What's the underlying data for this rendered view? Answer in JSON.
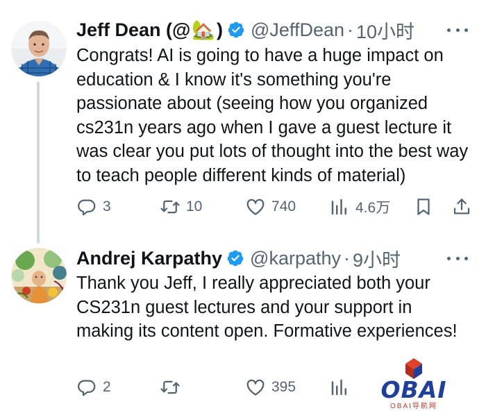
{
  "tweets": [
    {
      "name": "Jeff Dean (@",
      "name_emoji": "🏡",
      "name_suffix": ")",
      "handle": "@JeffDean",
      "time": "10小时",
      "text": "Congrats! AI is going to have a huge impact on education & I know it's something you're passionate about (seeing how you organized cs231n years ago when I gave a guest lecture it was clear you put lots of thought into the best way to teach people different kinds of material)",
      "replies": "3",
      "retweets": "10",
      "likes": "740",
      "views": "4.6万"
    },
    {
      "name": "Andrej Karpathy",
      "handle": "@karpathy",
      "time": "9小时",
      "text": "Thank you Jeff, I really appreciated both your CS231n guest lectures and your support in making its content open. Formative experiences!",
      "replies": "2",
      "likes": "395"
    }
  ],
  "separator": "·",
  "watermark": {
    "main": "OBAI",
    "sub": "OBAI导航网"
  },
  "colors": {
    "verified": "#1d9bf0",
    "secondary_text": "#536471",
    "thread_line": "#cfd9de"
  },
  "icons": [
    "verified-badge-icon",
    "more-icon",
    "reply-icon",
    "retweet-icon",
    "like-icon",
    "views-icon",
    "bookmark-icon",
    "share-icon"
  ]
}
